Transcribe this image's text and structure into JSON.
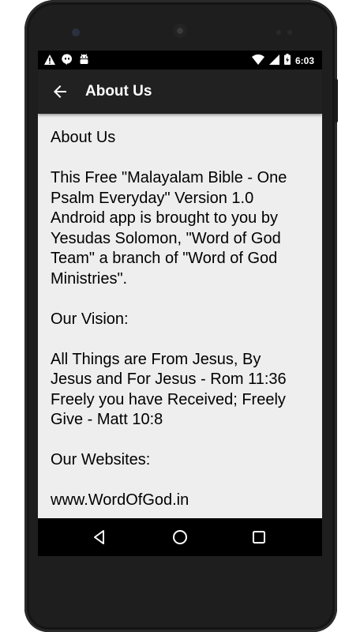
{
  "status": {
    "time": "6:03",
    "left_icons": [
      "warning-icon",
      "hangouts-icon",
      "android-debug-icon"
    ],
    "right_icons": [
      "wifi-icon",
      "cell-signal-icon",
      "battery-charging-icon"
    ]
  },
  "appbar": {
    "title": "About Us",
    "back_icon": "arrow-back-icon"
  },
  "content": {
    "heading": "About Us",
    "intro_lines": [
      "This Free \"Malayalam Bible - One",
      "Psalm Everyday\" Version 1.0",
      "Android app is brought to you by",
      "Yesudas Solomon, \"Word of God",
      "Team\" a branch of \"Word of God",
      "Ministries\"."
    ],
    "vision_heading": "Our Vision:",
    "vision_lines": [
      "All Things are From Jesus, By",
      "Jesus and For Jesus - Rom 11:36",
      "Freely you have Received; Freely",
      "Give - Matt 10:8"
    ],
    "websites_heading": "Our Websites:",
    "website_1": "www.WordOfGod.in"
  },
  "navbar": {
    "buttons": [
      "back-triangle-icon",
      "home-circle-icon",
      "recents-square-icon"
    ]
  }
}
